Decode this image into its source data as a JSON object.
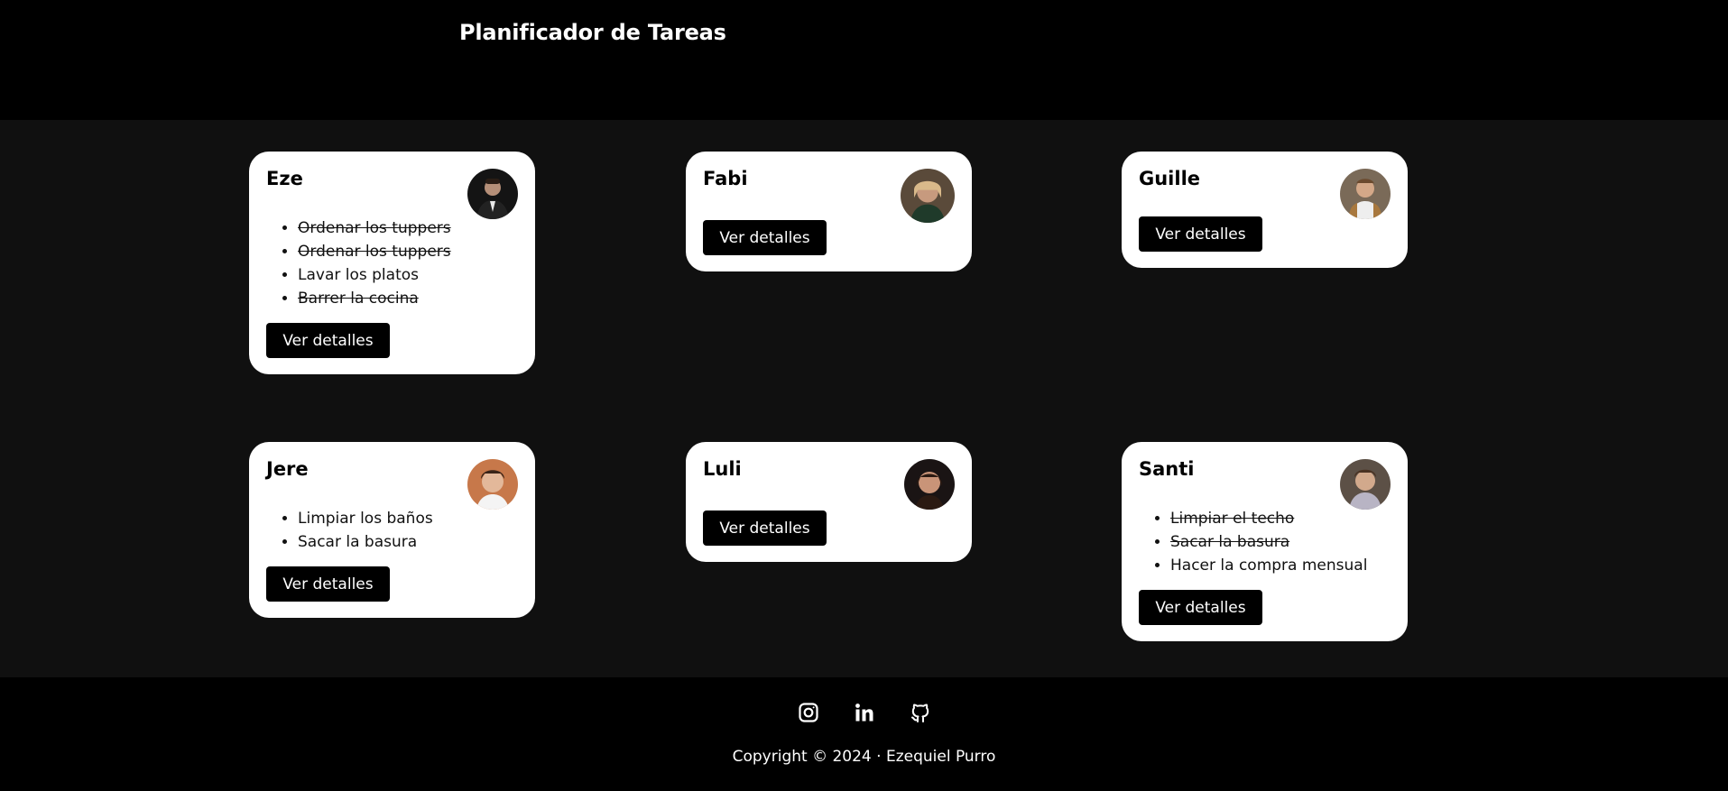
{
  "header": {
    "title": "Planificador de Tareas"
  },
  "cards": [
    {
      "name": "Eze",
      "avatar": "person-avatar-icon",
      "tasks": [
        {
          "label": "Ordenar los tuppers",
          "done": true
        },
        {
          "label": "Ordenar los tuppers",
          "done": true
        },
        {
          "label": "Lavar los platos",
          "done": false
        },
        {
          "label": "Barrer la cocina",
          "done": true
        }
      ],
      "button_label": "Ver detalles"
    },
    {
      "name": "Fabi",
      "avatar": "person-avatar-icon",
      "tasks": [],
      "button_label": "Ver detalles"
    },
    {
      "name": "Guille",
      "avatar": "person-avatar-icon",
      "tasks": [],
      "button_label": "Ver detalles"
    },
    {
      "name": "Jere",
      "avatar": "person-avatar-icon",
      "tasks": [
        {
          "label": "Limpiar los baños",
          "done": false
        },
        {
          "label": "Sacar la basura",
          "done": false
        }
      ],
      "button_label": "Ver detalles"
    },
    {
      "name": "Luli",
      "avatar": "person-avatar-icon",
      "tasks": [],
      "button_label": "Ver detalles"
    },
    {
      "name": "Santi",
      "avatar": "person-avatar-icon",
      "tasks": [
        {
          "label": "Limpiar el techo",
          "done": true
        },
        {
          "label": "Sacar la basura",
          "done": true
        },
        {
          "label": "Hacer la compra mensual",
          "done": false
        }
      ],
      "button_label": "Ver detalles"
    }
  ],
  "footer": {
    "social": [
      "instagram-icon",
      "linkedin-icon",
      "github-icon"
    ],
    "copyright": "Copyright © 2024 · Ezequiel Purro"
  },
  "colors": {
    "header_bg": "#000000",
    "main_bg": "#101010",
    "card_bg": "#ffffff",
    "button_bg": "#000000",
    "text_light": "#ffffff"
  }
}
